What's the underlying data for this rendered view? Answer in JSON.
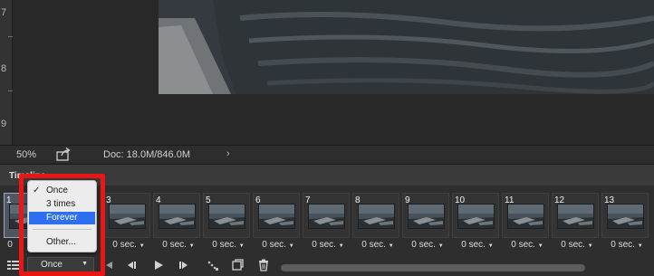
{
  "ruler": {
    "labels": [
      "7",
      "8",
      "9"
    ]
  },
  "status": {
    "zoom": "50%",
    "doc_label": "Doc: 18.0M/846.0M",
    "arrow": "›"
  },
  "panel": {
    "title": "Timeline"
  },
  "frames": [
    {
      "number": "1",
      "delay": "0"
    },
    {
      "number": "3",
      "delay": "0 sec."
    },
    {
      "number": "4",
      "delay": "0 sec."
    },
    {
      "number": "5",
      "delay": "0 sec."
    },
    {
      "number": "6",
      "delay": "0 sec."
    },
    {
      "number": "7",
      "delay": "0 sec."
    },
    {
      "number": "8",
      "delay": "0 sec."
    },
    {
      "number": "9",
      "delay": "0 sec."
    },
    {
      "number": "10",
      "delay": "0 sec."
    },
    {
      "number": "11",
      "delay": "0 sec."
    },
    {
      "number": "12",
      "delay": "0 sec."
    },
    {
      "number": "13",
      "delay": "0 sec."
    }
  ],
  "loop": {
    "selected": "Once",
    "options": [
      "Once",
      "3 times",
      "Forever",
      "Other..."
    ],
    "checked": "Once",
    "hovered": "Forever"
  },
  "colors": {
    "highlight": "#ea1515",
    "menu_active": "#2d6ff0",
    "panel_bg": "#2e2e2e"
  },
  "icons": {
    "panel_menu": "list-options-icon",
    "first_frame": "first-frame-icon",
    "previous_frame": "previous-frame-icon",
    "play": "play-icon",
    "next_frame": "next-frame-icon",
    "tween": "tween-icon",
    "duplicate": "duplicate-frame-icon",
    "delete": "trash-icon",
    "share": "share-icon"
  }
}
